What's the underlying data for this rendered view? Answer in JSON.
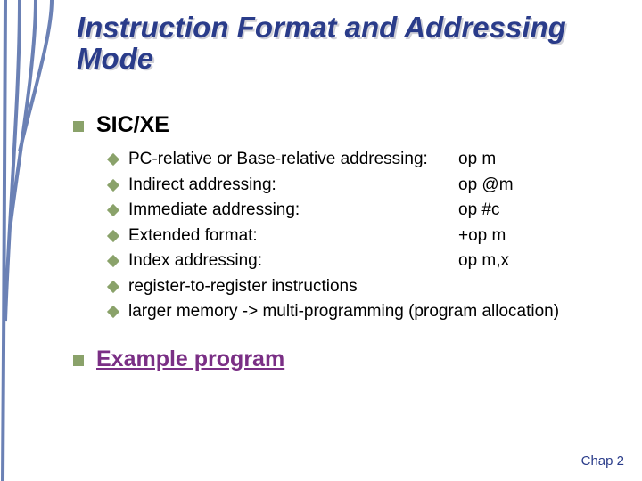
{
  "title": "Instruction Format and Addressing Mode",
  "section": "SIC/XE",
  "items": [
    {
      "left": "PC-relative or Base-relative addressing:",
      "right": "op m"
    },
    {
      "left": "Indirect addressing:",
      "right": "op @m"
    },
    {
      "left": "Immediate addressing:",
      "right": "op #c"
    },
    {
      "left": "Extended format:",
      "right": "+op m"
    },
    {
      "left": "Index addressing:",
      "right": "op m,x"
    },
    {
      "left": "register-to-register instructions",
      "right": ""
    },
    {
      "left": "larger memory -> multi-programming (program allocation)",
      "right": ""
    }
  ],
  "link": "Example program",
  "footer": "Chap 2"
}
